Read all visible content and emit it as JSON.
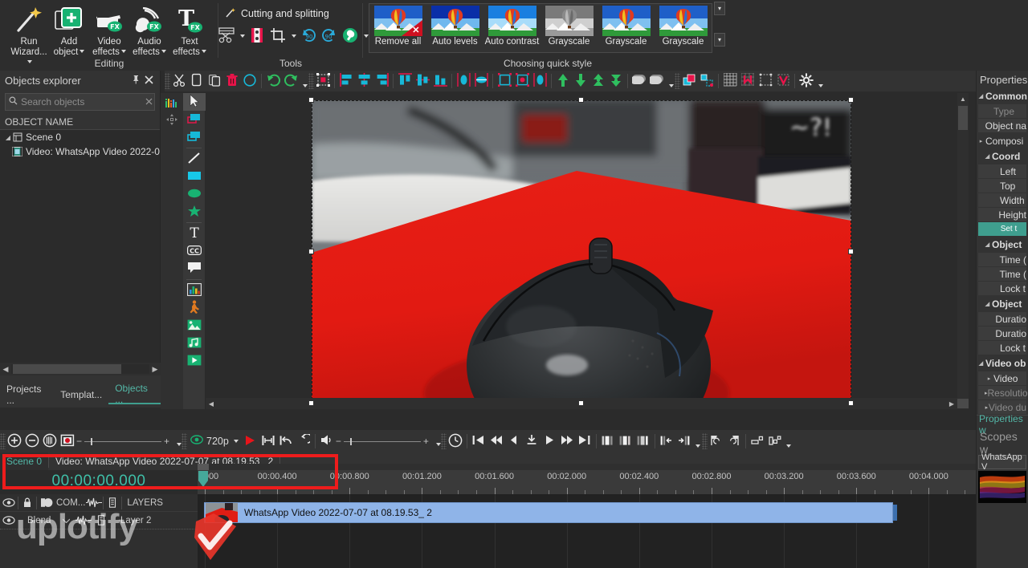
{
  "ribbon": {
    "editing": {
      "label": "Editing",
      "buttons": [
        {
          "label": "Run\nWizard...",
          "icon": "wand-icon",
          "caret": true
        },
        {
          "label": "Add\nobject",
          "icon": "add-object-icon",
          "caret": true
        },
        {
          "label": "Video\neffects",
          "icon": "video-effects-icon",
          "caret": true
        },
        {
          "label": "Audio\neffects",
          "icon": "audio-effects-icon",
          "caret": true
        },
        {
          "label": "Text\neffects",
          "icon": "text-effects-icon",
          "caret": true
        }
      ]
    },
    "tools": {
      "label": "Tools",
      "cutting_label": "Cutting and splitting",
      "cutting_icon": "wand-small-icon",
      "buttons": [
        {
          "icon": "scissors-split-icon",
          "caret": true
        },
        {
          "icon": "slice-marker-icon",
          "caret": false
        },
        {
          "icon": "crop-icon",
          "caret": true
        },
        {
          "icon": "rotate-cw-90-icon",
          "caret": false
        },
        {
          "icon": "rotate-ccw-90-icon",
          "caret": false
        },
        {
          "icon": "wrench-tools-icon",
          "caret": true
        }
      ]
    },
    "quick_style": {
      "label": "Choosing quick style",
      "items": [
        {
          "label": "Remove all",
          "style": "removeall"
        },
        {
          "label": "Auto levels",
          "style": "levels"
        },
        {
          "label": "Auto contrast",
          "style": "contrast"
        },
        {
          "label": "Grayscale",
          "style": "gray"
        },
        {
          "label": "Grayscale",
          "style": "normal"
        },
        {
          "label": "Grayscale",
          "style": "normal"
        }
      ],
      "scroll_down_icon": "chevron-down-icon",
      "scroll_more_icon": "chevron-expand-icon"
    }
  },
  "objects_explorer": {
    "title": "Objects explorer",
    "pin_icon": "pin-icon",
    "close_icon": "close-icon",
    "search": {
      "placeholder": "Search objects",
      "value": "",
      "icon": "search-icon",
      "clear_icon": "clear-icon"
    },
    "column_header": "OBJECT NAME",
    "tree": [
      {
        "label": "Scene 0",
        "icon": "scene-icon",
        "depth": 0,
        "expander": "expanded"
      },
      {
        "label": "Video: WhatsApp Video 2022-0",
        "icon": "video-clip-icon",
        "depth": 1,
        "expander": "none"
      }
    ],
    "tabs": [
      {
        "label": "Projects ...",
        "active": false
      },
      {
        "label": "Templat...",
        "active": false
      },
      {
        "label": "Objects ...",
        "active": true
      }
    ],
    "scroll_left_icon": "chevron-left-icon",
    "scroll_right_icon": "chevron-right-icon"
  },
  "tool_palette": {
    "items": [
      {
        "icon": "cursor-arrow-icon",
        "active": true
      },
      {
        "icon": "shape-rect-red-icon",
        "active": false
      },
      {
        "icon": "shape-rect-blue-icon",
        "active": false
      },
      {
        "sep": true
      },
      {
        "icon": "line-tool-icon",
        "active": false
      },
      {
        "icon": "rectangle-tool-icon",
        "active": false
      },
      {
        "icon": "ellipse-tool-icon",
        "active": false
      },
      {
        "icon": "star-tool-icon",
        "active": false
      },
      {
        "sep": true
      },
      {
        "icon": "text-tool-icon",
        "active": false
      },
      {
        "icon": "subtitle-cc-tool-icon",
        "active": false
      },
      {
        "icon": "callout-bubble-tool-icon",
        "active": false
      },
      {
        "sep": true
      },
      {
        "icon": "chart-tool-icon",
        "active": false
      },
      {
        "icon": "animation-person-tool-icon",
        "active": false
      },
      {
        "icon": "image-tool-icon",
        "active": false
      },
      {
        "icon": "audio-tool-icon",
        "active": false
      },
      {
        "icon": "video-tool-icon",
        "active": false
      }
    ],
    "strip_items": [
      {
        "icon": "equalizer-icon"
      },
      {
        "icon": "move-handle-icon"
      }
    ]
  },
  "editor_toolbar": {
    "groups": [
      [
        "cut-icon",
        "copy-icon",
        "paste-icon",
        "delete-icon",
        "select-circle-icon"
      ],
      [
        "undo-icon",
        "redo-icon"
      ],
      [
        "transform-object-icon"
      ],
      [
        "align-left-icon",
        "align-center-h-icon",
        "align-right-icon"
      ],
      [
        "align-top-icon",
        "align-middle-v-icon",
        "align-bottom-icon"
      ],
      [
        "distribute-h-icon",
        "distribute-v-icon"
      ],
      [
        "fit-width-icon",
        "fit-rect-icon",
        "fit-center-icon"
      ],
      [
        "move-up-icon",
        "move-down-icon",
        "move-top-icon",
        "move-bottom-icon"
      ],
      [
        "shadow-icon",
        "shadow-options-icon"
      ],
      [
        "group-icon",
        "ungroup-icon"
      ],
      [
        "grid-icon",
        "snap-grid-icon",
        "guides-icon",
        "snap-guides-icon"
      ],
      [
        "gear-icon"
      ]
    ]
  },
  "preview": {
    "scene_content": "black computer mouse on red mousepad",
    "handles": 8
  },
  "playbar": {
    "zoom_in_icon": "zoom-in-icon",
    "zoom_out_icon": "zoom-out-icon",
    "zoom_fit_icon": "zoom-fit-icon",
    "snapshot_icon": "snapshot-icon",
    "zoom_slider": {
      "minus": "-",
      "plus": "+"
    },
    "quality": {
      "label": "720p",
      "icon": "eye-icon",
      "caret": true
    },
    "render_icon": "render-play-icon",
    "range_icon": "range-icon",
    "loop_back_icon": "loop-back-icon",
    "loop_icon": "loop-icon",
    "volume_icon": "volume-icon",
    "volume_slider": {
      "minus": "-",
      "plus": "+"
    },
    "clock_icon": "clock-icon",
    "transport": [
      "skip-start-icon",
      "rewind-icon",
      "step-back-icon",
      "mark-icon",
      "play-icon",
      "fast-forward-icon",
      "skip-end-icon"
    ],
    "frame_icons": [
      "frame-prev-icon",
      "frame-mid-icon",
      "frame-next-icon"
    ],
    "trim_icons": [
      "trim-in-icon",
      "trim-out-icon"
    ],
    "marker_icons": [
      "marker-add-icon",
      "marker-remove-icon"
    ],
    "keyframe_icons": [
      "keyframe-left-icon",
      "keyframe-right-icon"
    ]
  },
  "timeline": {
    "breadcrumb": [
      {
        "label": "Scene 0",
        "active": true
      },
      {
        "label": "Video: WhatsApp Video 2022-07-07 at 08.19.53_ 2",
        "active": false
      }
    ],
    "timecode": "00:00:00.000",
    "ruler": {
      "labels": [
        "000",
        "00:00.400",
        "00:00.800",
        "00:01.200",
        "00:01.600",
        "00:02.000",
        "00:02.400",
        "00:02.800",
        "00:03.200",
        "00:03.600",
        "00:04.000"
      ],
      "start_seconds": 0,
      "end_seconds": 4.3,
      "minor_per_major": 4
    },
    "track_header": {
      "icons": [
        "eye-icon",
        "lock-icon",
        "blend-mode-icon"
      ],
      "com_label": "COM...",
      "waveform_icon": "waveform-icon",
      "note_icon": "note-icon",
      "layers_label": "LAYERS"
    },
    "track_row": {
      "eye_icon": "eye-icon",
      "blend_label": "Blend",
      "blend_caret": true,
      "waveform_icon": "waveform-icon",
      "note_icon": "note-icon",
      "layer_label": "Layer 2"
    },
    "clip": {
      "label": "WhatsApp Video 2022-07-07 at 08.19.53_ 2",
      "thumb": "video-thumb"
    },
    "annotation": {
      "type": "red-rectangle",
      "color": "#ee1c1c"
    }
  },
  "properties": {
    "title": "Properties",
    "rows": [
      {
        "label": "Common",
        "type": "group",
        "indent": 0,
        "expander": "expanded"
      },
      {
        "label": "Type",
        "type": "field-dim",
        "indent": 1
      },
      {
        "label": "Object na",
        "type": "field",
        "indent": 1
      },
      {
        "label": "Composi",
        "type": "row",
        "indent": 0,
        "expander": "collapsed"
      },
      {
        "label": "Coord",
        "type": "group",
        "indent": 1,
        "expander": "expanded"
      },
      {
        "label": "Left",
        "type": "field",
        "indent": 2
      },
      {
        "label": "Top",
        "type": "field",
        "indent": 2
      },
      {
        "label": "Width",
        "type": "field",
        "indent": 2
      },
      {
        "label": "Height",
        "type": "field",
        "indent": 2
      },
      {
        "label": "Set t",
        "type": "button",
        "indent": 2
      },
      {
        "label": "Object",
        "type": "group",
        "indent": 1,
        "expander": "expanded"
      },
      {
        "label": "Time (",
        "type": "field",
        "indent": 2
      },
      {
        "label": "Time (",
        "type": "field",
        "indent": 2
      },
      {
        "label": "Lock t",
        "type": "field",
        "indent": 2
      },
      {
        "label": "Object",
        "type": "group",
        "indent": 1,
        "expander": "expanded"
      },
      {
        "label": "Duratio",
        "type": "field",
        "indent": 2
      },
      {
        "label": "Duratio",
        "type": "field",
        "indent": 2
      },
      {
        "label": "Lock t",
        "type": "field",
        "indent": 2
      },
      {
        "label": "Video ob",
        "type": "group",
        "indent": 0,
        "expander": "expanded"
      },
      {
        "label": "Video",
        "type": "field",
        "indent": 1,
        "expander": "collapsed"
      },
      {
        "label": "Resolutio",
        "type": "field-dim",
        "indent": 1,
        "expander": "collapsed"
      },
      {
        "label": "Video du",
        "type": "field-dim",
        "indent": 1,
        "expander": "collapsed"
      }
    ],
    "bottom_tab": "Properties w",
    "scopes_title": "Scopes w",
    "scopes_selection": "WhatsApp V"
  },
  "watermark": {
    "text": "uplotify",
    "logo": "check-mark-logo"
  },
  "colors": {
    "accent_teal": "#3f9e8e",
    "annotation_red": "#ee1c1c",
    "clip_blue": "#8fb4e8",
    "panel_bg": "#333333",
    "canvas_bg": "#2b2b2b"
  }
}
